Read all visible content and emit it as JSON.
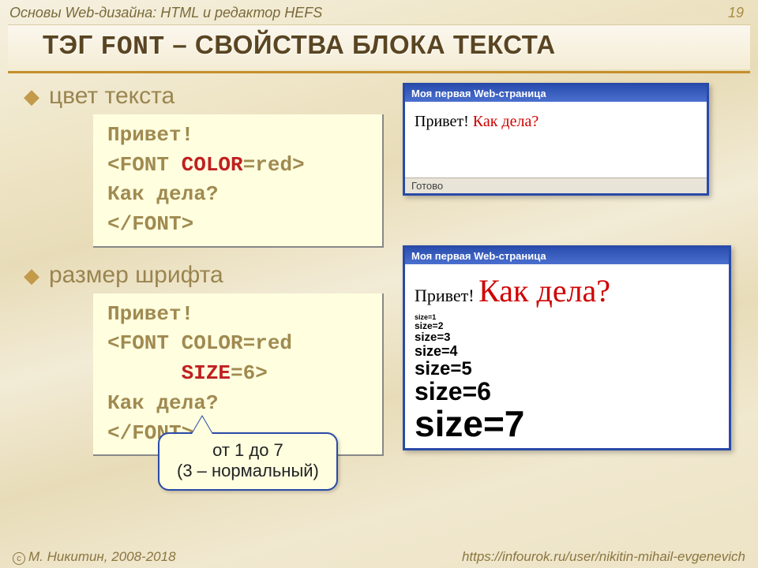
{
  "header": {
    "doc_title": "Основы Web-дизайна: HTML и редактор HEFS",
    "page_number": "19"
  },
  "title": {
    "pre": "ТЭГ ",
    "font_word": "FONT",
    "post": " – СВОЙСТВА БЛОКА ТЕКСТА"
  },
  "bullets": {
    "color": "цвет текста",
    "size": "размер шрифта"
  },
  "code1": {
    "l1": "Привет!",
    "l2a": "<FONT ",
    "l2b": "COLOR",
    "l2c": "=red>",
    "l3": "Как дела?",
    "l4": "</FONT>"
  },
  "code2": {
    "l1": "Привет!",
    "l2": "<FONT COLOR=red",
    "l3a": "      ",
    "l3b": "SIZE",
    "l3c": "=6>",
    "l4": "Как дела?",
    "l5": "</FONT>"
  },
  "window_title": "Моя первая Web-страница",
  "win1": {
    "black": "Привет! ",
    "red": "Как дела?",
    "status": "Готово"
  },
  "win2": {
    "black": "Привет! ",
    "red": "Как дела?",
    "sizes": [
      "size=1",
      "size=2",
      "size=3",
      "size=4",
      "size=5",
      "size=6",
      "size=7"
    ]
  },
  "callout": {
    "l1": "от 1 до 7",
    "l2": "(3 – нормальный)"
  },
  "footer": {
    "author": "М. Никитин, 2008-2018",
    "url": "https://infourok.ru/user/nikitin-mihail-evgenevich"
  }
}
